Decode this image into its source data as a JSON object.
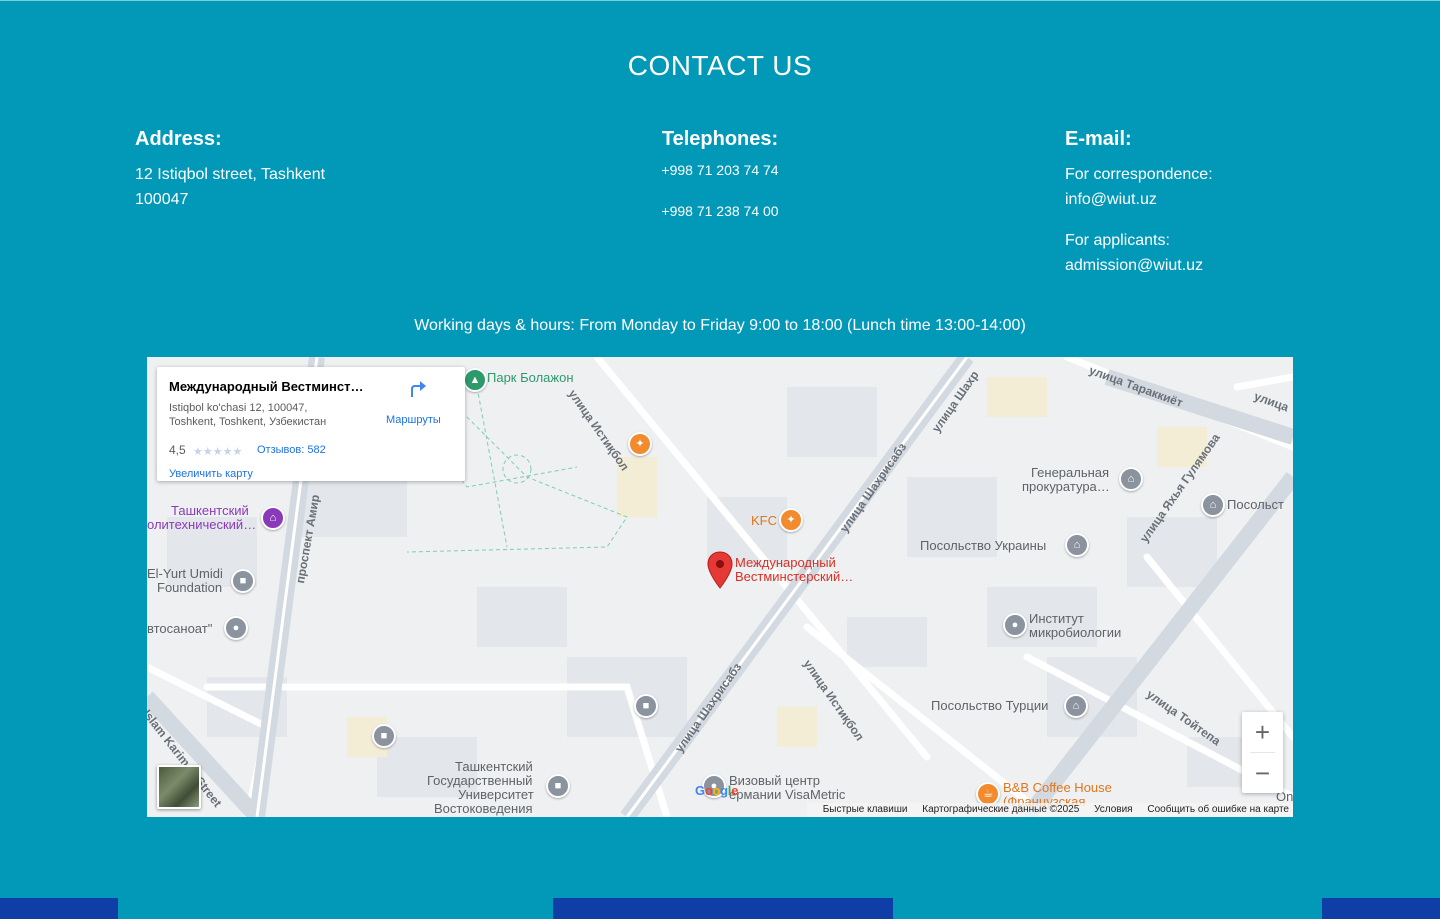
{
  "title": "CONTACT US",
  "address": {
    "heading": "Address:",
    "line1": "12 Istiqbol street, Tashkent",
    "line2": "100047"
  },
  "telephones": {
    "heading": "Telephones:",
    "numbers": [
      "+998 71 203 74 74",
      "+998 71 238 74 00"
    ]
  },
  "email": {
    "heading": "E-mail:",
    "correspondence_label": "For correspondence:",
    "correspondence_value": "info@wiut.uz",
    "applicants_label": "For applicants:",
    "applicants_value": "admission@wiut.uz"
  },
  "hours": "Working days & hours: From Monday to Friday 9:00 to 18:00 (Lunch time 13:00-14:00)",
  "map": {
    "info_card": {
      "place_name": "Международный Вестминст…",
      "address_line1": "Istiqbol ko'chasi 12, 100047,",
      "address_line2": "Toshkent, Toshkent, Узбекистан",
      "rating": "4,5",
      "reviews": "Отзывов: 582",
      "enlarge": "Увеличить карту",
      "directions": "Маршруты"
    },
    "labels": {
      "park": "Парк Болажон",
      "kfc": "KFC",
      "marker_line1": "Международный",
      "marker_line2": "Вестминстерский…",
      "prosecutor_line1": "Генеральная",
      "prosecutor_line2": "прокуратура…",
      "embassy_ukraine": "Посольство Украины",
      "embassy_right": "Посольст",
      "institute_line1": "Институт",
      "institute_line2": "микробиологии",
      "embassy_turkey": "Посольство Турции",
      "tashkent_poly_line1": "Ташкентский",
      "tashkent_poly_line2": "олитехнический…",
      "el_yurt_line1": "El-Yurt Umidi",
      "el_yurt_line2": "Foundation",
      "avtosanoat": "втосаноат\"",
      "university_line1": "Ташкентский",
      "university_line2": "Государственный",
      "university_line3": "Университет",
      "university_line4": "Востоковедения",
      "visa_line1": "Визовый центр",
      "visa_line2": "ермании VisaMetric",
      "coffee_line1": "B&B Coffee House",
      "coffee_line2": "(Французская",
      "on": "On"
    },
    "streets": {
      "istiqbol_top": "улица Истиқбол",
      "istiqbol_bottom": "улица Истиқбол",
      "shahrisabz_top": "улица Шахрисабз",
      "shahrisabz_bottom": "улица Шахрисабз",
      "shahri": "улица Шахр",
      "taraqqiyot": "улица Тараккиёт",
      "ulica_right": "улица",
      "yahyo": "улица Яхья Гулямова",
      "toytepa": "улица Тойтепа",
      "amir": "проспект Амир",
      "karimov": "Islam Karimov Street"
    },
    "logo": "Google",
    "attribution": [
      "Быстрые клавиши",
      "Картографические данные ©2025",
      "Условия",
      "Сообщить об ошибке на карте"
    ],
    "zoom_in": "+",
    "zoom_out": "−"
  }
}
